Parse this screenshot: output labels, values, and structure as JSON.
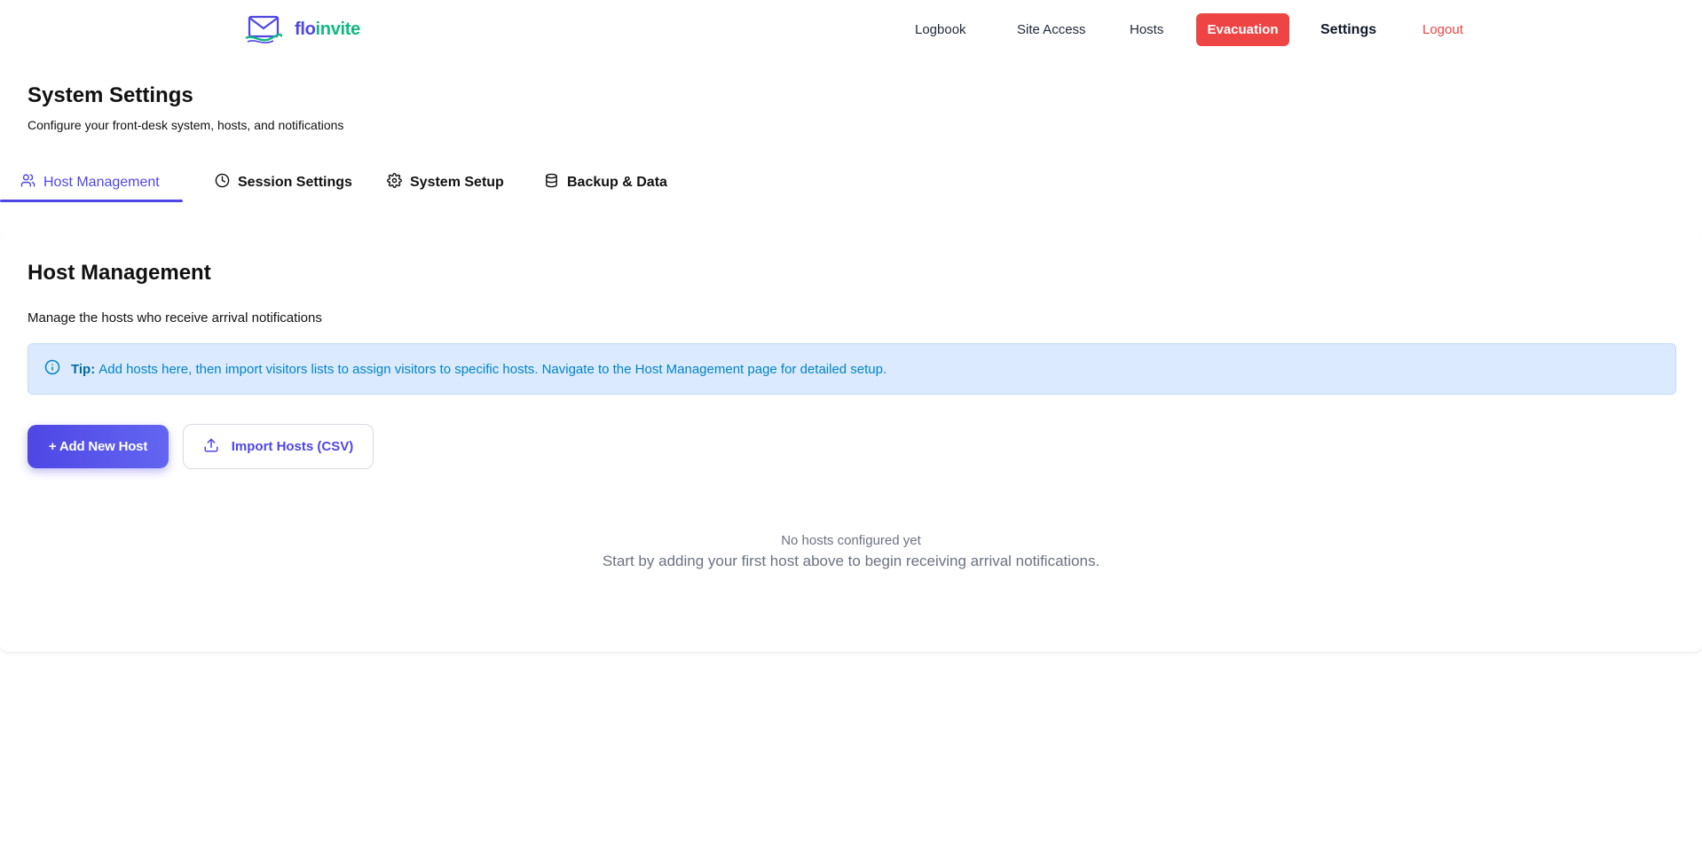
{
  "brand": {
    "name_part1": "flo",
    "name_part2": "invite",
    "colors": {
      "primary": "#4f46e5",
      "secondary": "#10b981"
    }
  },
  "nav": {
    "items": [
      {
        "label": "Logbook"
      },
      {
        "label": "Site Access"
      },
      {
        "label": "Hosts"
      },
      {
        "label": "Evacuation",
        "color": "#ef4444"
      },
      {
        "label": "Settings",
        "active": true
      },
      {
        "label": "Logout",
        "color": "#ef4444"
      }
    ]
  },
  "page": {
    "title": "System Settings",
    "subtitle": "Configure your front-desk system, hosts, and notifications"
  },
  "tabs": [
    {
      "label": "Host Management",
      "icon": "users-icon",
      "active": true
    },
    {
      "label": "Session Settings",
      "icon": "clock-icon"
    },
    {
      "label": "System Setup",
      "icon": "gear-icon"
    },
    {
      "label": "Backup & Data",
      "icon": "database-icon"
    }
  ],
  "host_management": {
    "title": "Host Management",
    "description": "Manage the hosts who receive arrival notifications",
    "tip": {
      "label": "Tip:",
      "text": "Add hosts here, then import visitors lists to assign visitors to specific hosts. Navigate to the Host Management page for detailed setup."
    },
    "add_button": "+ Add New Host",
    "import_button": "Import Hosts (CSV)",
    "empty_state": {
      "title": "No hosts configured yet",
      "description": "Start by adding your first host above to begin receiving arrival notifications."
    }
  }
}
